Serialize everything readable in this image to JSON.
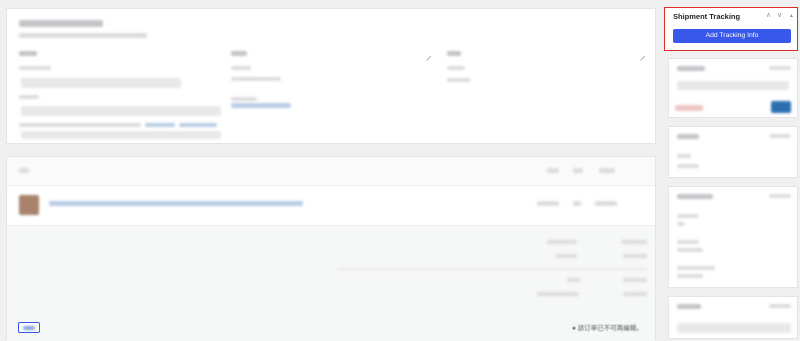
{
  "shipment_tracking": {
    "title": "Shipment Tracking",
    "add_button_label": "Add Tracking Info",
    "controls": {
      "move_up": "∧",
      "move_down": "∨",
      "toggle": "▲"
    }
  },
  "colors": {
    "accent": "#3858e9",
    "highlight_border": "#e02b27",
    "page_bg": "#f0f0f1",
    "panel_bg": "#ffffff"
  },
  "icons": {
    "pencil": "pencil-icon",
    "remove": "remove-icon",
    "product_thumbnail": "product-thumbnail-icon"
  },
  "footer_note": "● 該订单已不可再编辑。"
}
